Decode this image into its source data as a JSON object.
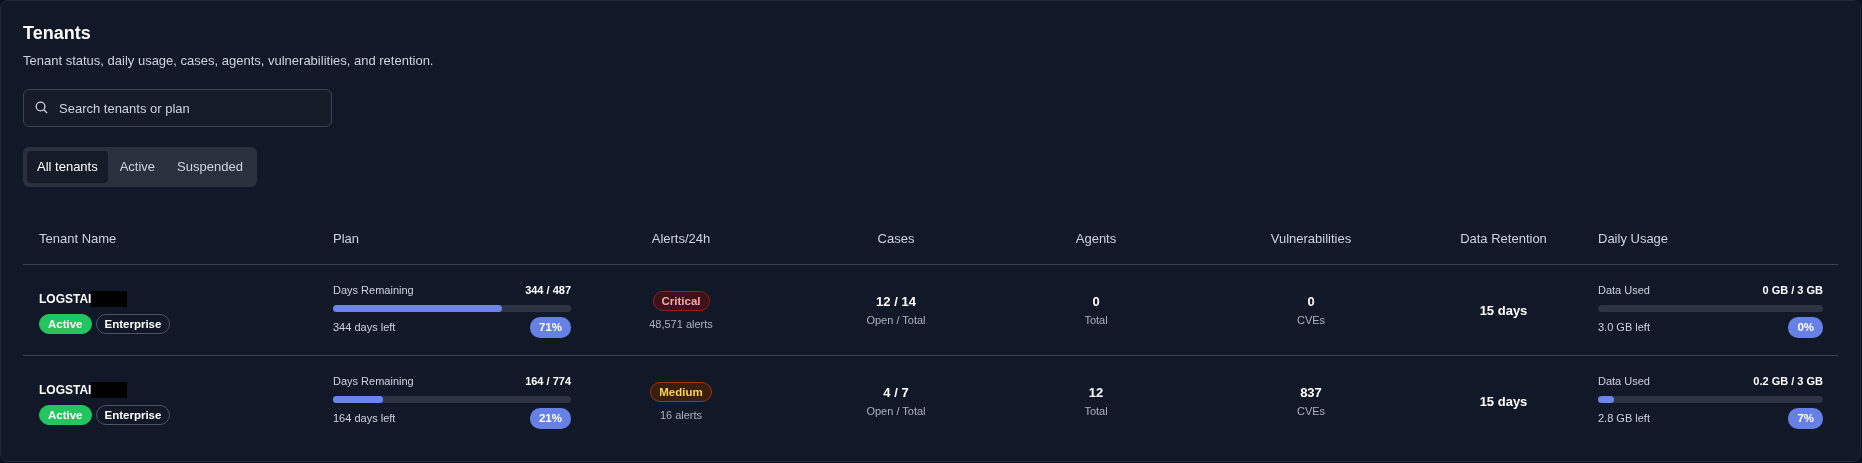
{
  "header": {
    "title": "Tenants",
    "subtitle": "Tenant status, daily usage, cases, agents, vulnerabilities, and retention."
  },
  "search": {
    "placeholder": "Search tenants or plan"
  },
  "filters": [
    {
      "label": "All tenants",
      "selected": true
    },
    {
      "label": "Active",
      "selected": false
    },
    {
      "label": "Suspended",
      "selected": false
    }
  ],
  "table": {
    "columns": [
      "Tenant Name",
      "Plan",
      "Alerts/24h",
      "Cases",
      "Agents",
      "Vulnerabilities",
      "Data Retention",
      "Daily Usage"
    ],
    "rows": [
      {
        "tenant": {
          "name": "LOGSTAI",
          "status": {
            "label": "Active",
            "kind": "active"
          },
          "tier": "Enterprise"
        },
        "plan": {
          "label": "Days Remaining",
          "value": "344 / 487",
          "level": 0.71,
          "remaining": "344 days left",
          "percent": "71%"
        },
        "alerts": {
          "label": "Critical",
          "kind": "critical",
          "count": "48,571 alerts"
        },
        "cases": {
          "value": "12 / 14",
          "caption": "Open / Total"
        },
        "agents": {
          "value": "0",
          "caption": "Total"
        },
        "vulnerabilities": {
          "value": "0",
          "caption": "CVEs"
        },
        "retention": "15 days",
        "usage": {
          "label": "Data Used",
          "value": "0 GB / 3 GB",
          "remaining": "3.0 GB left",
          "percent": "0%"
        }
      },
      {
        "tenant": {
          "name": "LOGSTAI",
          "status": {
            "label": "Active",
            "kind": "active"
          },
          "tier": "Enterprise"
        },
        "plan": {
          "label": "Days Remaining",
          "value": "164 / 774",
          "level": 0.21,
          "remaining": "164 days left",
          "percent": "21%"
        },
        "alerts": {
          "label": "Medium",
          "kind": "medium",
          "count": "16 alerts"
        },
        "cases": {
          "value": "4 / 7",
          "caption": "Open / Total"
        },
        "agents": {
          "value": "12",
          "caption": "Total"
        },
        "vulnerabilities": {
          "value": "837",
          "caption": "CVEs"
        },
        "retention": "15 days",
        "usage": {
          "label": "Data Used",
          "value": "0.2 GB / 3 GB",
          "level": 0.07,
          "remaining": "2.8 GB left",
          "percent": "7%"
        }
      }
    ]
  }
}
